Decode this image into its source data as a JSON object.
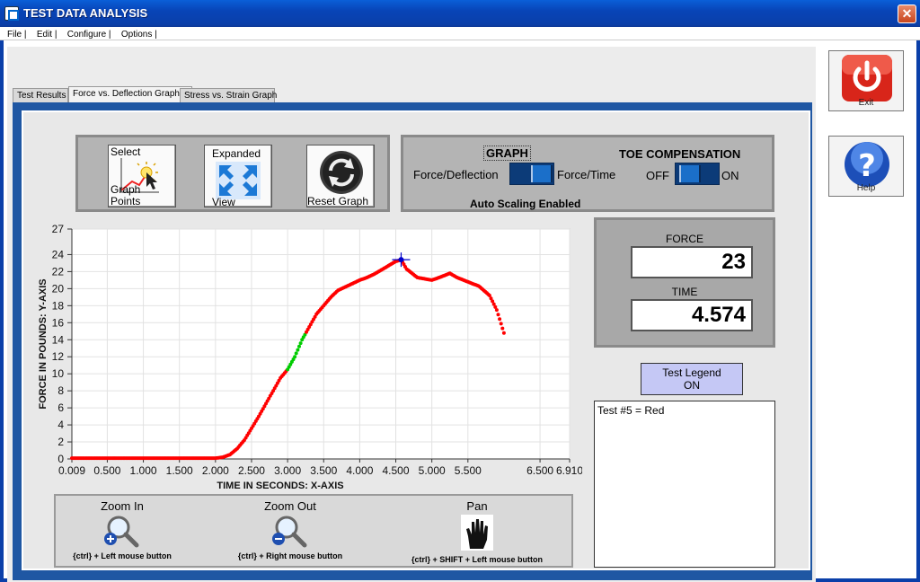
{
  "window": {
    "title": "TEST DATA ANALYSIS",
    "close_glyph": "✕"
  },
  "menu": [
    "File |",
    "Edit |",
    "Configure |",
    "Options |"
  ],
  "tabs": [
    "Test Results",
    "Force vs. Deflection Graph",
    "Stress vs. Strain Graph"
  ],
  "toolbar": {
    "select_top": "Select",
    "select_mid": "Graph",
    "select_bottom": "Points",
    "expanded_top": "Expanded",
    "expanded_bottom": "View",
    "reset_label": "Reset Graph"
  },
  "graph_switch": {
    "title": "GRAPH",
    "left_label": "Force/Deflection",
    "right_label": "Force/Time",
    "status": "Auto Scaling Enabled"
  },
  "toe_switch": {
    "title": "TOE COMPENSATION",
    "off_label": "OFF",
    "on_label": "ON"
  },
  "readout": {
    "force_label": "FORCE",
    "force_value": "23",
    "time_label": "TIME",
    "time_value": "4.574"
  },
  "legend": {
    "button_line1": "Test Legend",
    "button_line2": "ON",
    "entries": [
      "Test #5 = Red"
    ]
  },
  "zoom": {
    "zoom_in_title": "Zoom In",
    "zoom_in_hint": "{ctrl} + Left mouse button",
    "zoom_out_title": "Zoom Out",
    "zoom_out_hint": "{ctrl} + Right mouse button",
    "pan_title": "Pan",
    "pan_hint": "{ctrl} + SHIFT + Left mouse button"
  },
  "side_buttons": {
    "exit_label": "Exit",
    "help_label": "Help"
  },
  "colors": {
    "trace": "#ff0000",
    "selection": "#00cc00",
    "cursor": "#0000cc"
  },
  "icons": [
    "select-points-icon",
    "expand-icon",
    "reset-icon",
    "zoom-in-icon",
    "zoom-out-icon",
    "pan-hand-icon",
    "power-icon",
    "help-icon"
  ],
  "chart_data": {
    "type": "scatter",
    "xlabel": "TIME IN SECONDS: X-AXIS",
    "ylabel": "FORCE IN POUNDS: Y-AXIS",
    "xlim": [
      0.009,
      6.91
    ],
    "ylim": [
      0,
      27
    ],
    "x_ticks": [
      "0.009",
      "0.500",
      "1.000",
      "1.500",
      "2.000",
      "2.500",
      "3.000",
      "3.500",
      "4.000",
      "4.500",
      "5.000",
      "5.500",
      "6.500",
      "6.910"
    ],
    "x_tick_values": [
      0.009,
      0.5,
      1.0,
      1.5,
      2.0,
      2.5,
      3.0,
      3.5,
      4.0,
      4.5,
      5.0,
      5.5,
      6.5,
      6.91
    ],
    "y_ticks": [
      0,
      2,
      4,
      6,
      8,
      10,
      12,
      14,
      16,
      18,
      20,
      22,
      24,
      27
    ],
    "grid": true,
    "series": [
      {
        "x": [
          0.009,
          0.5,
          1.0,
          1.5,
          2.0,
          2.1,
          2.2,
          2.3,
          2.4,
          2.5,
          2.6,
          2.7,
          2.8,
          2.9,
          3.0,
          3.1,
          3.2,
          3.3,
          3.4,
          3.5,
          3.6,
          3.7,
          3.8,
          3.9,
          4.0,
          4.1,
          4.2,
          4.3,
          4.4,
          4.5,
          4.574,
          4.65,
          4.8,
          5.0,
          5.1,
          5.25,
          5.35,
          5.5,
          5.65,
          5.8,
          5.9,
          6.0
        ],
        "y": [
          0.1,
          0.1,
          0.1,
          0.1,
          0.1,
          0.2,
          0.5,
          1.2,
          2.2,
          3.6,
          5.0,
          6.5,
          8.0,
          9.5,
          10.5,
          12.0,
          14.0,
          15.5,
          17.0,
          18.0,
          19.0,
          19.8,
          20.2,
          20.6,
          21.0,
          21.3,
          21.7,
          22.2,
          22.7,
          23.2,
          23.4,
          22.3,
          21.3,
          21.0,
          21.3,
          21.8,
          21.3,
          20.8,
          20.3,
          19.2,
          17.5,
          14.8
        ]
      }
    ],
    "selection_x_range": [
      3.0,
      3.25
    ],
    "cursor": {
      "x": 4.574,
      "y": 23.4
    }
  }
}
